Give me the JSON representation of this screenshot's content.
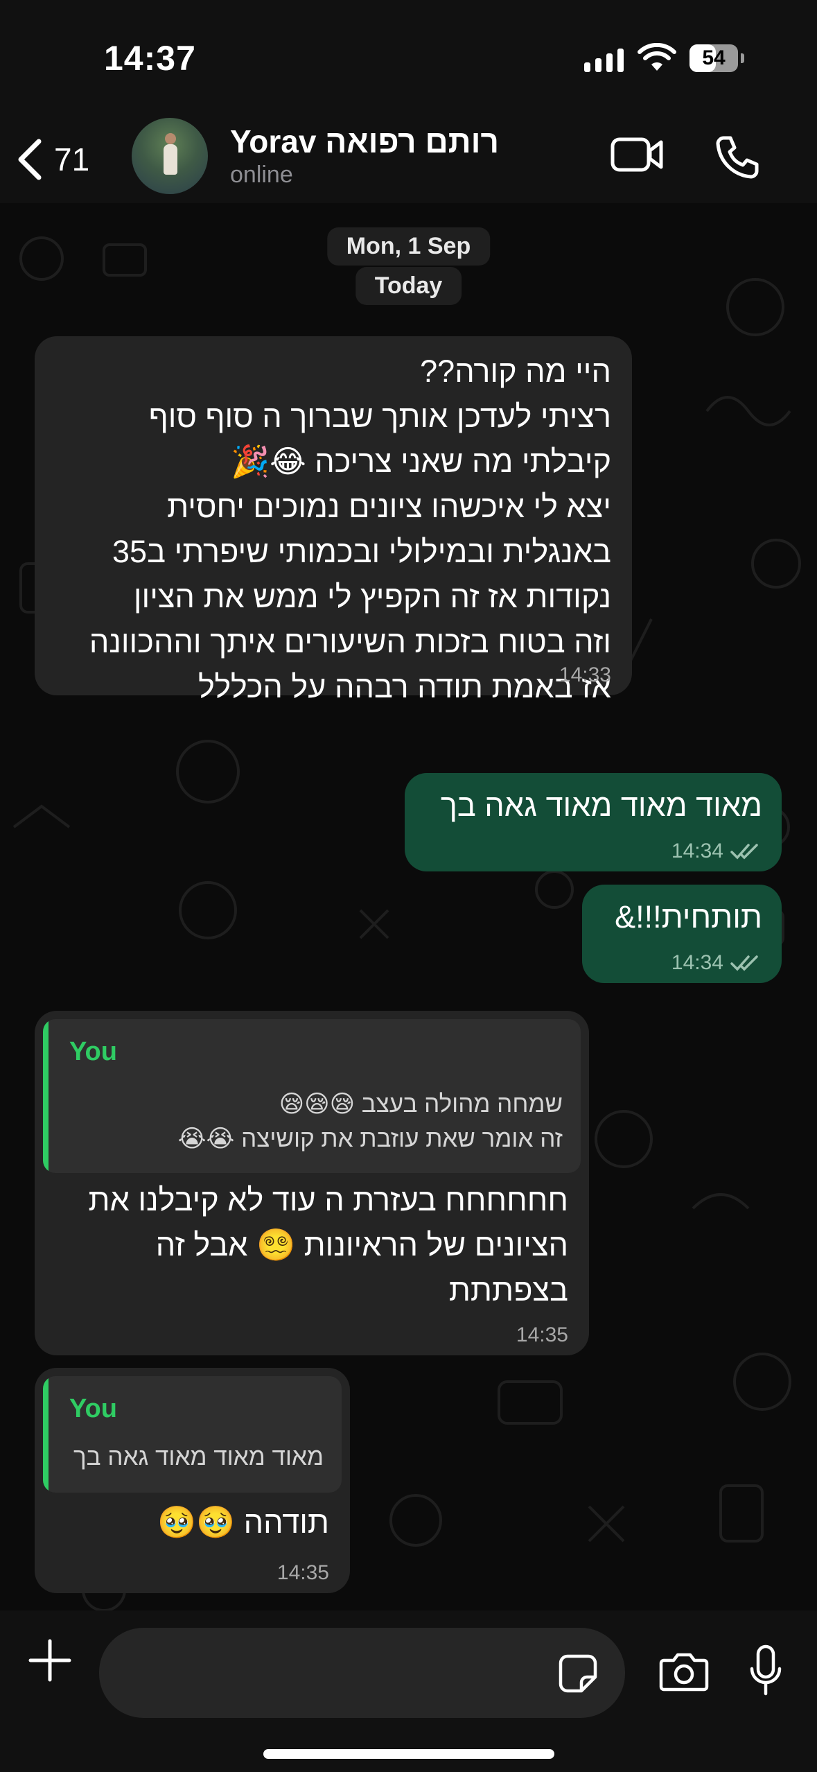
{
  "status_bar": {
    "time": "14:37",
    "battery": "54",
    "battery_level": 0.54
  },
  "header": {
    "back_count": "71",
    "contact_name": "רותם רפואה Yorav",
    "contact_status": "online",
    "icons": {
      "back": "chevron-left-icon",
      "video": "video-camera-icon",
      "call": "phone-icon"
    }
  },
  "chat": {
    "date_chips": [
      "Mon, 1 Sep",
      "Today"
    ],
    "messages": [
      {
        "direction": "incoming",
        "lines": [
          "היי מה קורה??",
          "רציתי לעדכן אותך שברוך ה סוף סוף",
          "קיבלתי מה שאני צריכה 😂🎉",
          "יצא לי איכשהו ציונים נמוכים יחסית",
          "באנגלית ובמילולי ובכמותי שיפרתי ב35",
          "נקודות אז זה הקפיץ לי ממש את הציון",
          "וזה בטוח בזכות השיעורים איתך וההכוונה",
          "אז באמת תודה רבהה על הכללל"
        ],
        "time": "14:33"
      },
      {
        "direction": "outgoing",
        "text": "מאוד מאוד מאוד גאה בך",
        "time": "14:34",
        "status": "read"
      },
      {
        "direction": "outgoing",
        "text": "תותחית!!!&",
        "time": "14:34",
        "status": "read"
      },
      {
        "direction": "incoming",
        "quote": {
          "author": "You",
          "lines": [
            "שמחה מהולה בעצב 😪😪😪",
            "זה אומר שאת עוזבת את קושיצה 😭😭"
          ]
        },
        "lines": [
          "חחחחחח בעזרת ה עוד לא קיבלנו את",
          "הציונים של הראיונות 😵‍💫 אבל זה",
          "בצפתתת"
        ],
        "time": "14:35"
      },
      {
        "direction": "incoming",
        "quote": {
          "author": "You",
          "lines": [
            "מאוד מאוד מאוד גאה בך"
          ]
        },
        "lines": [
          "תודהה 🥹🥹"
        ],
        "time": "14:35"
      }
    ]
  },
  "input_bar": {
    "placeholder": "",
    "icons": {
      "plus": "plus-icon",
      "sticker": "sticker-icon",
      "camera": "camera-icon",
      "mic": "microphone-icon"
    }
  },
  "colors": {
    "incoming_bubble": "#242424",
    "outgoing_bubble": "#134d37",
    "quote_accent": "#2fcc63",
    "background": "#0b0b0b"
  }
}
